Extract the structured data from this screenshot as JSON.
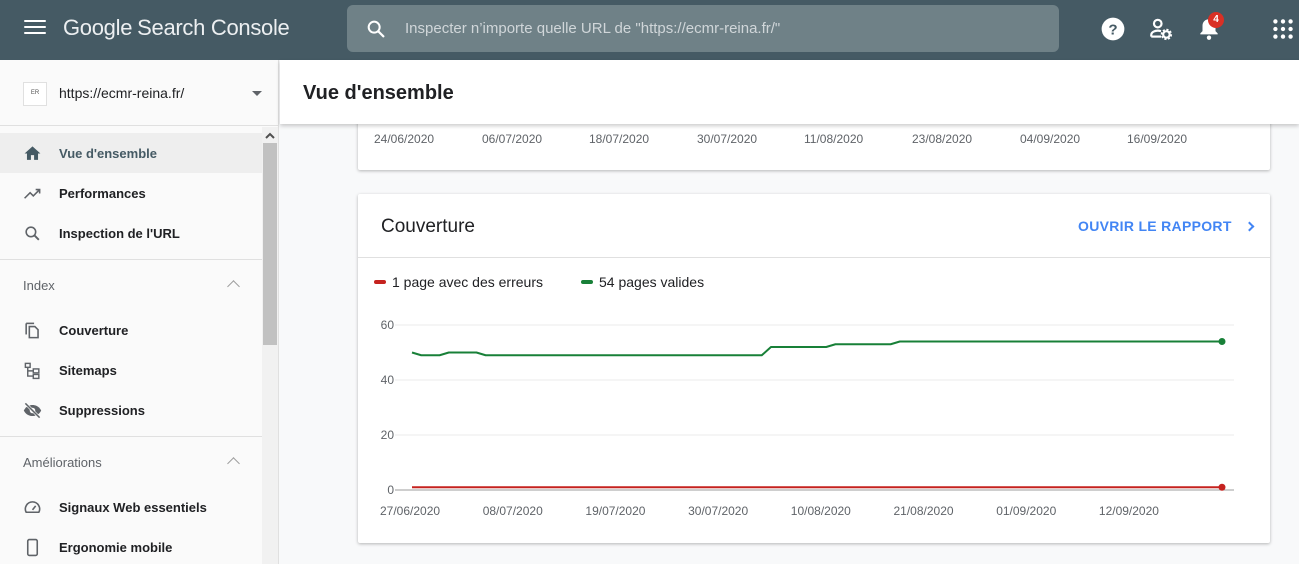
{
  "app": {
    "title_google": "Google",
    "title_product": "Search Console"
  },
  "search": {
    "placeholder": "Inspecter n’importe quelle URL de \"https://ecmr-reina.fr/\"",
    "value": ""
  },
  "topbar_icons": [
    "help-icon",
    "user-settings-icon",
    "notifications-icon",
    "apps-grid-icon"
  ],
  "notifications": {
    "count": "4",
    "badge_color": "#d93025"
  },
  "property": {
    "url": "https://ecmr-reina.fr/",
    "logo_text": "ER"
  },
  "sidebar": {
    "items": [
      {
        "label": "Vue d'ensemble",
        "icon": "home-icon",
        "active": true
      },
      {
        "label": "Performances",
        "icon": "trending-up-icon"
      },
      {
        "label": "Inspection de l'URL",
        "icon": "search-icon"
      }
    ],
    "sections": [
      {
        "label": "Index",
        "items": [
          {
            "label": "Couverture",
            "icon": "copy-pages-icon"
          },
          {
            "label": "Sitemaps",
            "icon": "sitemap-icon"
          },
          {
            "label": "Suppressions",
            "icon": "eye-off-icon"
          }
        ]
      },
      {
        "label": "Améliorations",
        "items": [
          {
            "label": "Signaux Web essentiels",
            "icon": "speedometer-icon"
          },
          {
            "label": "Ergonomie mobile",
            "icon": "smartphone-icon"
          }
        ]
      }
    ]
  },
  "header": {
    "title": "Vue d'ensemble"
  },
  "previous_card": {
    "x_ticks": [
      "24/06/2020",
      "06/07/2020",
      "18/07/2020",
      "30/07/2020",
      "11/08/2020",
      "23/08/2020",
      "04/09/2020",
      "16/09/2020"
    ]
  },
  "coverage_card": {
    "title": "Couverture",
    "open_report": "OUVRIR LE RAPPORT",
    "colors": {
      "errors": "#c5221f",
      "valid": "#188038",
      "link": "#4285f4"
    }
  },
  "chart_data": {
    "type": "line",
    "title": "Couverture",
    "xlabel": "",
    "ylabel": "",
    "ylim": [
      0,
      60
    ],
    "y_ticks": [
      0,
      20,
      40,
      60
    ],
    "x_ticks": [
      "27/06/2020",
      "08/07/2020",
      "19/07/2020",
      "30/07/2020",
      "10/08/2020",
      "21/08/2020",
      "01/09/2020",
      "12/09/2020"
    ],
    "x_range": [
      "27/06/2020",
      "23/09/2020"
    ],
    "grid": true,
    "legend_position": "top-left",
    "series": [
      {
        "name": "1 page avec des erreurs",
        "color": "#c5221f",
        "points": [
          {
            "day": 0,
            "value": 1
          },
          {
            "day": 88,
            "value": 1
          }
        ]
      },
      {
        "name": "54 pages valides",
        "color": "#188038",
        "points": [
          {
            "day": 0,
            "value": 50
          },
          {
            "day": 1,
            "value": 49
          },
          {
            "day": 3,
            "value": 49
          },
          {
            "day": 4,
            "value": 50
          },
          {
            "day": 7,
            "value": 50
          },
          {
            "day": 8,
            "value": 49
          },
          {
            "day": 38,
            "value": 49
          },
          {
            "day": 39,
            "value": 52
          },
          {
            "day": 45,
            "value": 52
          },
          {
            "day": 46,
            "value": 53
          },
          {
            "day": 52,
            "value": 53
          },
          {
            "day": 53,
            "value": 54
          },
          {
            "day": 88,
            "value": 54
          }
        ]
      }
    ]
  }
}
